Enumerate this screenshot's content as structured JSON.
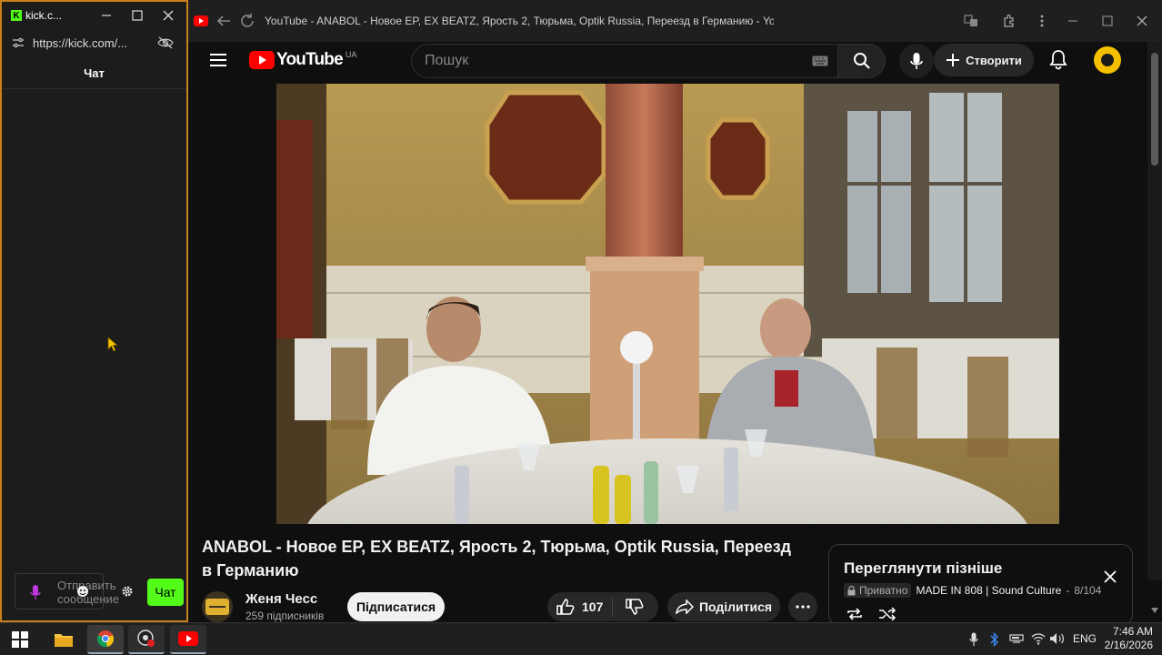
{
  "kick": {
    "title": "kick.c...",
    "url": "https://kick.com/...",
    "chat_header": "Чат",
    "input_placeholder": "Отправить сообщение",
    "chat_button": "Чат",
    "brand_color": "#53fc18"
  },
  "youtube": {
    "window_title": "YouTube - ANABOL - Новое EP, EX BEATZ, Ярость 2, Тюрьма, Optik Russia, Переезд в Германию - YouTube",
    "logo_text": "YouTube",
    "logo_region": "UA",
    "search_placeholder": "Пошук",
    "create_label": "Створити",
    "video_title": "ANABOL - Новое EP, EX BEATZ, Ярость 2, Тюрьма, Optik Russia, Переезд в Германию",
    "channel_name": "Женя Чесс",
    "subscribers": "259 підписників",
    "subscribe_label": "Підписатися",
    "like_count": "107",
    "share_label": "Поділитися",
    "watch_later": {
      "title": "Переглянути пізніше",
      "private_label": "Приватно",
      "playlist_owner": "MADE IN 808 | Sound Culture",
      "position": "8/104"
    },
    "brand_color": "#ff0000"
  },
  "taskbar": {
    "language": "ENG",
    "time": "7:46 AM",
    "date": "2/16/2026"
  }
}
